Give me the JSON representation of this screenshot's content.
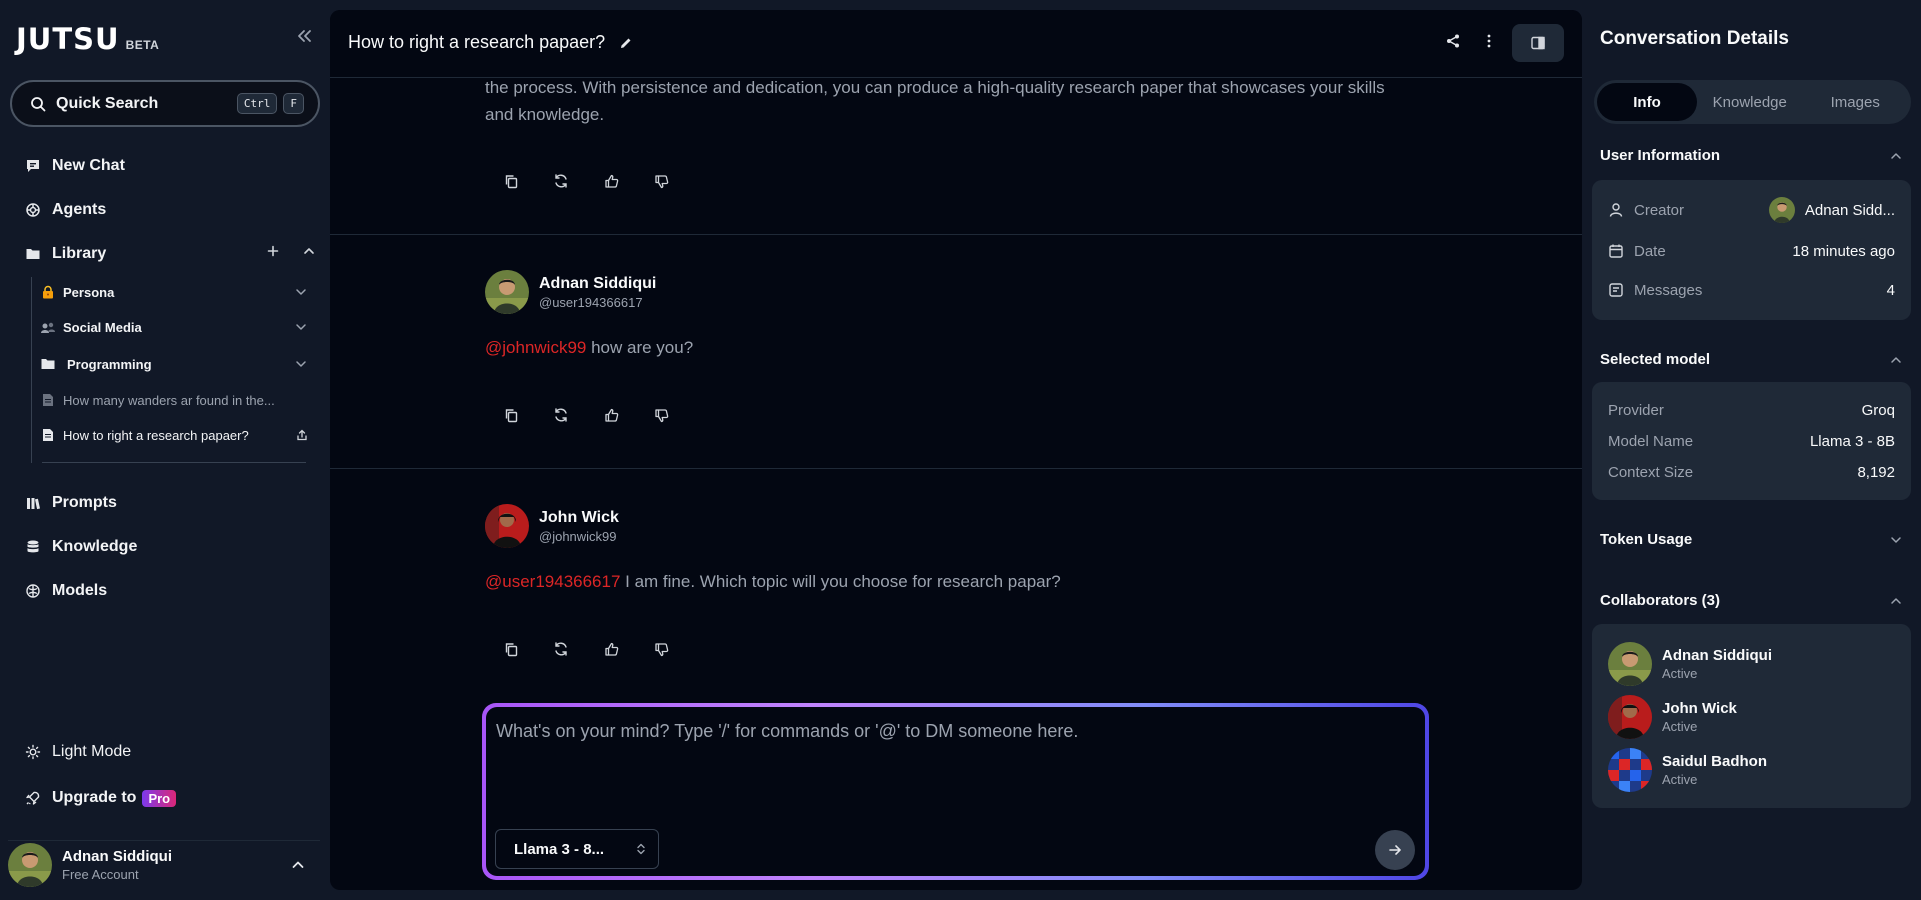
{
  "app": {
    "logo": "JUTSU",
    "beta": "BETA"
  },
  "sidebar": {
    "quick_search": {
      "label": "Quick Search",
      "key1": "Ctrl",
      "key2": "F"
    },
    "nav": {
      "new_chat": "New Chat",
      "agents": "Agents",
      "library": "Library",
      "prompts": "Prompts",
      "knowledge": "Knowledge",
      "models": "Models"
    },
    "library_items": [
      {
        "label": "Persona"
      },
      {
        "label": "Social Media"
      },
      {
        "label": "Programming"
      },
      {
        "label": "How many wanders ar found in the..."
      },
      {
        "label": "How to right a research papaer?"
      }
    ],
    "light_mode": "Light Mode",
    "upgrade": "Upgrade to",
    "pro": "Pro",
    "user": {
      "name": "Adnan Siddiqui",
      "plan": "Free Account"
    }
  },
  "main": {
    "title": "How to right a research papaer?",
    "messages": [
      {
        "text": "the process. With persistence and dedication, you can produce a high-quality research paper that showcases your skills and knowledge."
      },
      {
        "author": "Adnan Siddiqui",
        "handle": "@user194366617",
        "mention": "@johnwick99",
        "text": " how are you?"
      },
      {
        "author": "John Wick",
        "handle": "@johnwick99",
        "mention": "@user194366617",
        "text": " I am fine. Which topic will you choose for research papar?"
      }
    ],
    "composer": {
      "placeholder": "What's on your mind? Type '/' for commands or '@' to DM someone here.",
      "model": "Llama 3 - 8..."
    }
  },
  "panel": {
    "title": "Conversation Details",
    "tabs": [
      "Info",
      "Knowledge",
      "Images"
    ],
    "user_info": {
      "heading": "User Information",
      "creator_label": "Creator",
      "creator_value": "Adnan Sidd...",
      "date_label": "Date",
      "date_value": "18 minutes ago",
      "messages_label": "Messages",
      "messages_value": "4"
    },
    "model": {
      "heading": "Selected model",
      "provider_label": "Provider",
      "provider_value": "Groq",
      "name_label": "Model Name",
      "name_value": "Llama 3 - 8B",
      "context_label": "Context Size",
      "context_value": "8,192"
    },
    "token_usage": "Token Usage",
    "collaborators": {
      "heading": "Collaborators (3)",
      "list": [
        {
          "name": "Adnan Siddiqui",
          "status": "Active"
        },
        {
          "name": "John Wick",
          "status": "Active"
        },
        {
          "name": "Saidul Badhon",
          "status": "Active"
        }
      ]
    }
  },
  "colors": {
    "accent": "#dc2626",
    "background": "#030712",
    "sidebar": "#111827",
    "gradient_start": "#a855f7",
    "gradient_end": "#4f46e5"
  }
}
